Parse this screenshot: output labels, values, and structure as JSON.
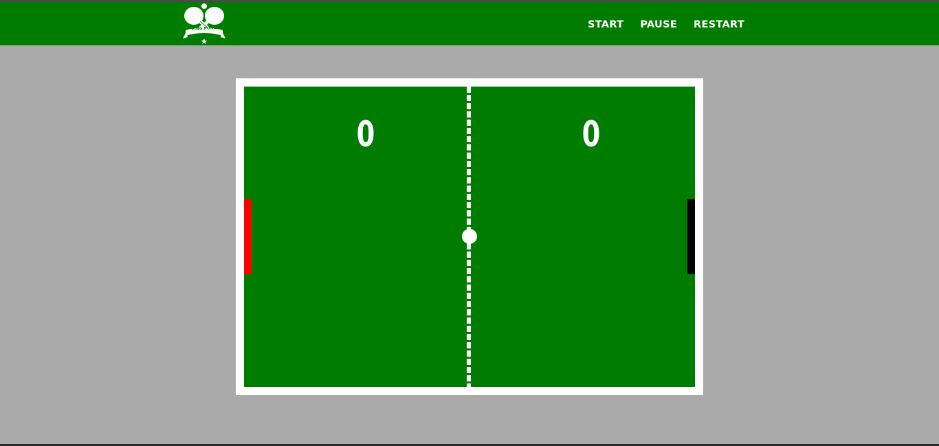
{
  "header": {
    "logo": {
      "icon": "ping-pong-paddles-icon",
      "text": "PING PONG"
    },
    "nav": [
      {
        "label": "START"
      },
      {
        "label": "PAUSE"
      },
      {
        "label": "RESTART"
      }
    ]
  },
  "game": {
    "score_left": "0",
    "score_right": "0",
    "colors": {
      "page_background": "#aaaaaa",
      "header_background": "#007c00",
      "court": "#007c00",
      "court_border": "#ffffff",
      "net": "#ffffff",
      "ball": "#ffffff",
      "left_paddle": "#ff0000",
      "right_paddle": "#000000"
    }
  }
}
